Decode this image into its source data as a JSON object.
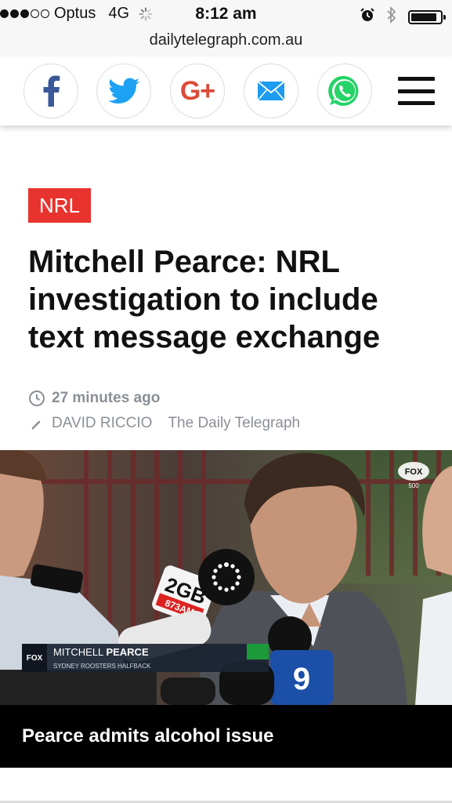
{
  "status_bar": {
    "carrier": "Optus",
    "network": "4G",
    "time": "8:12 am",
    "signal_bars_filled": 3,
    "signal_bars_total": 5,
    "battery_level": 0.9
  },
  "url_bar": {
    "domain": "dailytelegraph.com.au"
  },
  "share_bar": {
    "buttons": [
      {
        "name": "facebook",
        "icon": "facebook-icon",
        "color": "#3b5998"
      },
      {
        "name": "twitter",
        "icon": "twitter-icon",
        "color": "#1da1f2"
      },
      {
        "name": "google-plus",
        "icon": "google-plus-icon",
        "color": "#dd4b39"
      },
      {
        "name": "email",
        "icon": "email-icon",
        "color": "#1d9bf0"
      },
      {
        "name": "whatsapp",
        "icon": "whatsapp-icon",
        "color": "#25d366"
      }
    ],
    "google_plus_label": "G+"
  },
  "article": {
    "category": "NRL",
    "category_color": "#e8332e",
    "headline": "Mitchell Pearce: NRL investigation to include text message exchange",
    "timestamp": "27 minutes ago",
    "author": "DAVID RICCIO",
    "publication": "The Daily Telegraph"
  },
  "hero": {
    "broadcaster_logo": "FOX",
    "broadcaster_channel": "500",
    "lower_third_logo": "FOX",
    "lower_third_first": "MITCHELL",
    "lower_third_last": "PEARCE",
    "lower_third_subtitle": "SYDNEY ROOSTERS HALFBACK",
    "mic_left_label": "2GB",
    "mic_left_sublabel": "873AM",
    "mic_right_label": "9",
    "caption": "Pearce admits alcohol issue"
  }
}
